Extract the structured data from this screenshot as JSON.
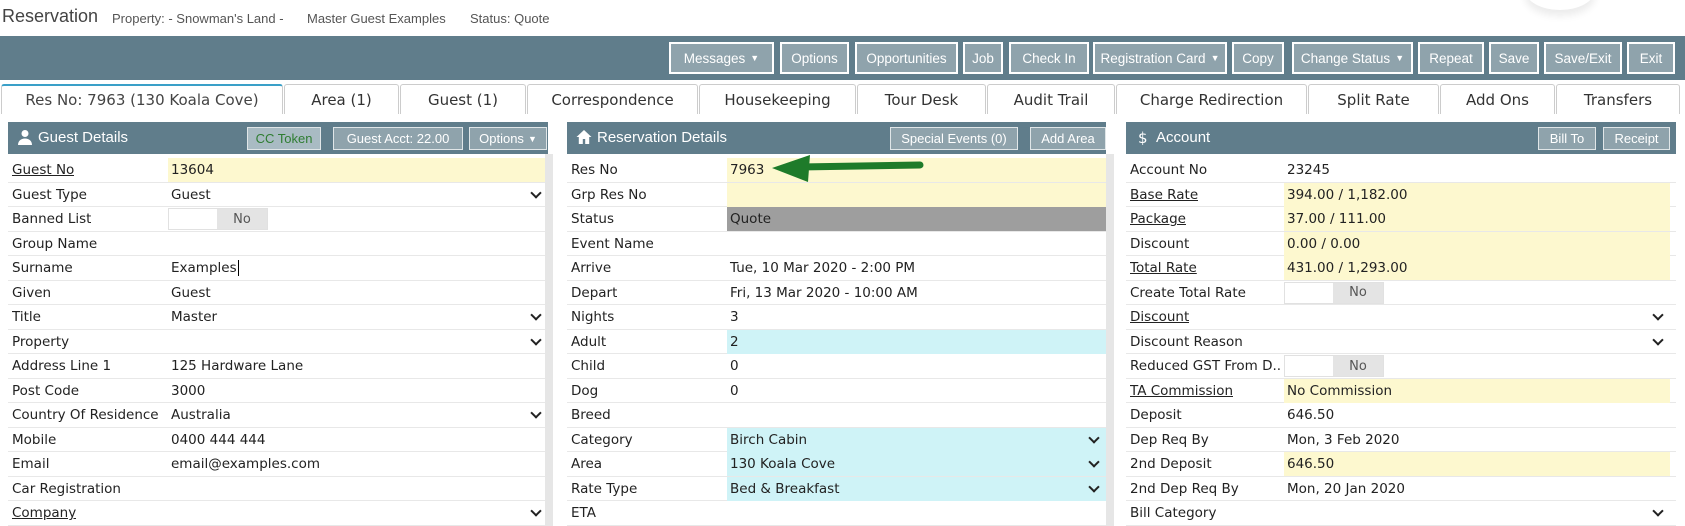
{
  "titlebar": {
    "title": "Reservation",
    "property": "Property: - Snowman's Land -",
    "guest": "Master Guest Examples",
    "status": "Status: Quote"
  },
  "toolbar": {
    "buttons": [
      {
        "label": "Messages",
        "caret": "▼"
      },
      {
        "label": "Options"
      },
      {
        "label": "Opportunities"
      },
      {
        "label": "Job"
      },
      {
        "label": "Check In"
      },
      {
        "label": "Registration Card",
        "caret": "▼"
      },
      {
        "label": "Copy"
      },
      {
        "label": "Change Status",
        "caret": "▼"
      },
      {
        "label": "Repeat"
      },
      {
        "label": "Save"
      },
      {
        "label": "Save/Exit"
      },
      {
        "label": "Exit"
      }
    ]
  },
  "tabs": [
    {
      "label": "Res No: 7963 (130 Koala Cove)",
      "active": true
    },
    {
      "label": "Area (1)"
    },
    {
      "label": "Guest (1)"
    },
    {
      "label": "Correspondence"
    },
    {
      "label": "Housekeeping"
    },
    {
      "label": "Tour Desk"
    },
    {
      "label": "Audit Trail"
    },
    {
      "label": "Charge Redirection"
    },
    {
      "label": "Split Rate"
    },
    {
      "label": "Add Ons"
    },
    {
      "label": "Transfers"
    }
  ],
  "guest_panel": {
    "title": "Guest Details",
    "icon": "person-icon",
    "buttons": {
      "cc_token": "CC Token",
      "guest_acct": "Guest Acct: 22.00",
      "options": "Options"
    },
    "caret": "▼",
    "rows": [
      {
        "label": "Guest No",
        "value": "13604"
      },
      {
        "label": "Guest Type",
        "value": "Guest"
      },
      {
        "label": "Banned List",
        "value": "No"
      },
      {
        "label": "Group Name",
        "value": ""
      },
      {
        "label": "Surname",
        "value": "Examples"
      },
      {
        "label": "Given",
        "value": "Guest"
      },
      {
        "label": "Title",
        "value": "Master"
      },
      {
        "label": "Property",
        "value": ""
      },
      {
        "label": "Address Line 1",
        "value": "125 Hardware Lane"
      },
      {
        "label": "Post Code",
        "value": "3000"
      },
      {
        "label": "Country Of Residence",
        "value": "Australia"
      },
      {
        "label": "Mobile",
        "value": "0400 444 444"
      },
      {
        "label": "Email",
        "value": "email@examples.com"
      },
      {
        "label": "Car Registration",
        "value": ""
      },
      {
        "label": "Company",
        "value": ""
      }
    ]
  },
  "res_panel": {
    "title": "Reservation Details",
    "icon": "home-icon",
    "buttons": {
      "special_events": "Special Events (0)",
      "add_area": "Add Area"
    },
    "rows": [
      {
        "label": "Res No",
        "value": "7963"
      },
      {
        "label": "Grp Res No",
        "value": ""
      },
      {
        "label": "Status",
        "value": "Quote"
      },
      {
        "label": "Event Name",
        "value": ""
      },
      {
        "label": "Arrive",
        "value": "Tue, 10 Mar 2020 - 2:00 PM"
      },
      {
        "label": "Depart",
        "value": "Fri, 13 Mar 2020 - 10:00 AM"
      },
      {
        "label": "Nights",
        "value": "3"
      },
      {
        "label": "Adult",
        "value": "2"
      },
      {
        "label": "Child",
        "value": "0"
      },
      {
        "label": "Dog",
        "value": "0"
      },
      {
        "label": "Breed",
        "value": ""
      },
      {
        "label": "Category",
        "value": "Birch Cabin"
      },
      {
        "label": "Area",
        "value": "130 Koala Cove"
      },
      {
        "label": "Rate Type",
        "value": "Bed & Breakfast"
      },
      {
        "label": "ETA",
        "value": ""
      }
    ]
  },
  "account_panel": {
    "title": "Account",
    "icon": "dollar-icon",
    "buttons": {
      "bill_to": "Bill To",
      "receipt": "Receipt"
    },
    "rows": [
      {
        "label": "Account No",
        "value": "23245"
      },
      {
        "label": "Base Rate",
        "value": "394.00 / 1,182.00"
      },
      {
        "label": "Package",
        "value": "37.00 / 111.00"
      },
      {
        "label": "Discount",
        "value": "0.00 / 0.00"
      },
      {
        "label": "Total Rate",
        "value": "431.00 / 1,293.00"
      },
      {
        "label": "Create Total Rate",
        "value": "No"
      },
      {
        "label": "Discount",
        "value": ""
      },
      {
        "label": "Discount Reason",
        "value": ""
      },
      {
        "label": "Reduced GST From D...",
        "value": "No"
      },
      {
        "label": "TA Commission",
        "value": "No Commission"
      },
      {
        "label": "Deposit",
        "value": "646.50"
      },
      {
        "label": "Dep Req By",
        "value": "Mon, 3 Feb 2020"
      },
      {
        "label": "2nd Deposit",
        "value": "646.50"
      },
      {
        "label": "2nd Dep Req By",
        "value": "Mon, 20 Jan 2020"
      },
      {
        "label": "Bill Category",
        "value": ""
      }
    ]
  },
  "colors": {
    "header": "#607d8b",
    "button": "#8fa3ac",
    "yellow": "#fdf8cf",
    "cyan": "#cff3f7",
    "arrow": "#1e7b2a"
  }
}
